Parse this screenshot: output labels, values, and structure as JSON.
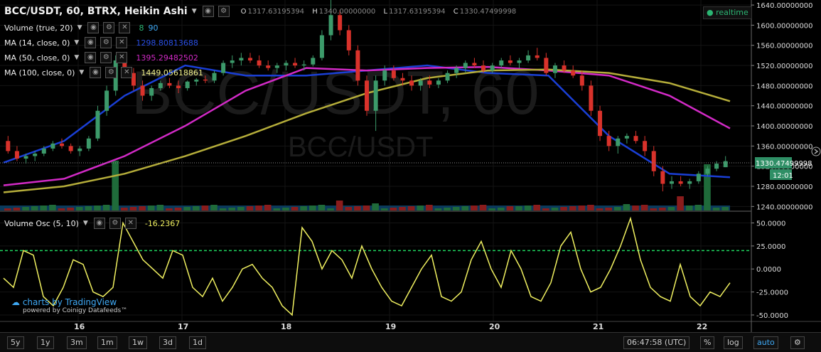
{
  "header": {
    "symbol": "BCC/USDT, 60, BTRX, Heikin Ashi",
    "o_label": "O",
    "o_val": "1317.63195394",
    "h_label": "H",
    "h_val": "1340.00000000",
    "l_label": "L",
    "l_val": "1317.63195394",
    "c_label": "C",
    "c_val": "1330.47499998",
    "realtime": "● realtime"
  },
  "indicators": [
    {
      "name": "Volume (true, 20)",
      "values": [
        "8",
        "90"
      ],
      "colors": [
        "#2bb673",
        "#3fa9f5"
      ]
    },
    {
      "name": "MA (14, close, 0)",
      "values": [
        "1298.80813688"
      ],
      "colors": [
        "#1a3fd6"
      ]
    },
    {
      "name": "MA (50, close, 0)",
      "values": [
        "1395.29482502"
      ],
      "colors": [
        "#d22ac6"
      ]
    },
    {
      "name": "MA (100, close, 0)",
      "values": [
        "1449.05618861"
      ],
      "colors": [
        "#f0f08a"
      ]
    }
  ],
  "osc_legend": {
    "name": "Volume Osc (5, 10)",
    "value": "-16.2367"
  },
  "watermark": {
    "text": "charts by TradingView",
    "sub": "powered by Coinigy Datafeeds™"
  },
  "background_text": {
    "big": "BCC/USDT, 60",
    "small": "BCC/USDT"
  },
  "price_axis": {
    "ticks": [
      1640,
      1600,
      1560,
      1520,
      1480,
      1440,
      1400,
      1360,
      1320,
      1280,
      1240
    ],
    "tick_labels": [
      "1640.00000000",
      "1600.00000000",
      "1560.00000000",
      "1520.00000000",
      "1480.00000000",
      "1440.00000000",
      "1400.00000000",
      "1360.00000000",
      "1320.00000000",
      "1280.00000000",
      "1240.00000000"
    ],
    "last_price": "1330.47499998",
    "countdown": "12:01",
    "range": [
      1232,
      1650
    ]
  },
  "osc_axis": {
    "ticks": [
      50,
      25,
      0,
      -25,
      -50
    ],
    "tick_labels": [
      "50.0000",
      "25.0000",
      "0.0000",
      "-25.0000",
      "-50.0000"
    ],
    "range": [
      -57,
      62
    ],
    "dashed_level": 20
  },
  "time_axis": {
    "labels": [
      "16",
      "17",
      "18",
      "19",
      "20",
      "21",
      "22"
    ]
  },
  "toolbar": {
    "ranges": [
      "5y",
      "1y",
      "3m",
      "1m",
      "1w",
      "3d",
      "1d"
    ],
    "time": "06:47:58 (UTC)",
    "pct": "%",
    "log": "log",
    "auto": "auto"
  },
  "colors": {
    "up": "#3c9a6a",
    "down": "#d9322b",
    "ma14": "#1a3fd6",
    "ma50": "#d22ac6",
    "ma100": "#b5ad3a",
    "osc": "#f0f060",
    "osc_level": "#1ed760"
  },
  "chart_data": {
    "type": "line",
    "xlabel": "",
    "ylabel": "",
    "x_labels": [
      "16",
      "17",
      "18",
      "19",
      "20",
      "21",
      "22"
    ],
    "series": [
      {
        "name": "MA (14, close, 0)",
        "values": [
          1327,
          1370,
          1460,
          1520,
          1500,
          1500,
          1510,
          1520,
          1505,
          1500,
          1380,
          1305,
          1298
        ]
      },
      {
        "name": "MA (50, close, 0)",
        "values": [
          1282,
          1295,
          1340,
          1400,
          1470,
          1515,
          1510,
          1515,
          1517,
          1510,
          1500,
          1460,
          1395
        ]
      },
      {
        "name": "MA (100, close, 0)",
        "values": [
          1268,
          1280,
          1305,
          1340,
          1380,
          1425,
          1465,
          1495,
          1510,
          1512,
          1505,
          1485,
          1449
        ]
      }
    ],
    "candles": [
      [
        1370,
        1380,
        1345,
        1350
      ],
      [
        1350,
        1360,
        1330,
        1335
      ],
      [
        1335,
        1345,
        1325,
        1340
      ],
      [
        1340,
        1350,
        1330,
        1345
      ],
      [
        1345,
        1360,
        1340,
        1355
      ],
      [
        1355,
        1370,
        1350,
        1365
      ],
      [
        1365,
        1375,
        1355,
        1360
      ],
      [
        1360,
        1365,
        1345,
        1350
      ],
      [
        1350,
        1360,
        1340,
        1355
      ],
      [
        1355,
        1380,
        1350,
        1375
      ],
      [
        1375,
        1440,
        1370,
        1430
      ],
      [
        1430,
        1480,
        1420,
        1470
      ],
      [
        1470,
        1540,
        1460,
        1530
      ],
      [
        1530,
        1545,
        1500,
        1505
      ],
      [
        1505,
        1515,
        1470,
        1480
      ],
      [
        1480,
        1490,
        1450,
        1460
      ],
      [
        1460,
        1480,
        1450,
        1475
      ],
      [
        1475,
        1490,
        1470,
        1485
      ],
      [
        1485,
        1495,
        1475,
        1480
      ],
      [
        1480,
        1490,
        1465,
        1475
      ],
      [
        1475,
        1490,
        1470,
        1488
      ],
      [
        1488,
        1495,
        1480,
        1492
      ],
      [
        1492,
        1500,
        1485,
        1490
      ],
      [
        1490,
        1510,
        1485,
        1505
      ],
      [
        1505,
        1530,
        1500,
        1525
      ],
      [
        1525,
        1540,
        1515,
        1530
      ],
      [
        1530,
        1545,
        1520,
        1535
      ],
      [
        1535,
        1545,
        1525,
        1530
      ],
      [
        1530,
        1540,
        1515,
        1520
      ],
      [
        1520,
        1530,
        1510,
        1515
      ],
      [
        1515,
        1525,
        1505,
        1520
      ],
      [
        1520,
        1530,
        1510,
        1525
      ],
      [
        1525,
        1535,
        1515,
        1520
      ],
      [
        1520,
        1530,
        1510,
        1522
      ],
      [
        1522,
        1540,
        1518,
        1535
      ],
      [
        1535,
        1590,
        1530,
        1580
      ],
      [
        1580,
        1650,
        1570,
        1620
      ],
      [
        1620,
        1630,
        1580,
        1590
      ],
      [
        1590,
        1600,
        1540,
        1550
      ],
      [
        1550,
        1560,
        1480,
        1490
      ],
      [
        1490,
        1500,
        1420,
        1430
      ],
      [
        1430,
        1500,
        1390,
        1490
      ],
      [
        1490,
        1520,
        1480,
        1510
      ],
      [
        1510,
        1520,
        1490,
        1495
      ],
      [
        1495,
        1505,
        1480,
        1490
      ],
      [
        1490,
        1500,
        1470,
        1480
      ],
      [
        1480,
        1495,
        1470,
        1490
      ],
      [
        1490,
        1500,
        1475,
        1482
      ],
      [
        1482,
        1495,
        1475,
        1490
      ],
      [
        1490,
        1510,
        1485,
        1505
      ],
      [
        1505,
        1520,
        1495,
        1515
      ],
      [
        1515,
        1530,
        1505,
        1525
      ],
      [
        1525,
        1535,
        1515,
        1520
      ],
      [
        1520,
        1530,
        1505,
        1510
      ],
      [
        1510,
        1525,
        1505,
        1520
      ],
      [
        1520,
        1535,
        1515,
        1530
      ],
      [
        1530,
        1540,
        1520,
        1525
      ],
      [
        1525,
        1535,
        1515,
        1530
      ],
      [
        1530,
        1550,
        1525,
        1540
      ],
      [
        1540,
        1555,
        1530,
        1535
      ],
      [
        1535,
        1545,
        1500,
        1505
      ],
      [
        1505,
        1525,
        1495,
        1520
      ],
      [
        1520,
        1530,
        1505,
        1510
      ],
      [
        1510,
        1520,
        1495,
        1500
      ],
      [
        1500,
        1510,
        1470,
        1480
      ],
      [
        1480,
        1490,
        1420,
        1430
      ],
      [
        1430,
        1440,
        1370,
        1380
      ],
      [
        1380,
        1390,
        1350,
        1360
      ],
      [
        1360,
        1380,
        1345,
        1375
      ],
      [
        1375,
        1385,
        1365,
        1380
      ],
      [
        1380,
        1390,
        1365,
        1370
      ],
      [
        1370,
        1380,
        1340,
        1350
      ],
      [
        1350,
        1360,
        1300,
        1310
      ],
      [
        1310,
        1320,
        1270,
        1285
      ],
      [
        1285,
        1300,
        1275,
        1290
      ],
      [
        1290,
        1300,
        1280,
        1285
      ],
      [
        1285,
        1295,
        1275,
        1290
      ],
      [
        1290,
        1310,
        1285,
        1305
      ],
      [
        1305,
        1320,
        1300,
        1315
      ],
      [
        1315,
        1330,
        1310,
        1325
      ],
      [
        1318,
        1340,
        1318,
        1330
      ]
    ],
    "volume_osc": [
      -10,
      -20,
      20,
      15,
      -30,
      -40,
      -20,
      10,
      5,
      -25,
      -30,
      -20,
      50,
      30,
      10,
      0,
      -10,
      20,
      15,
      -20,
      -30,
      -10,
      -35,
      -20,
      0,
      5,
      -10,
      -20,
      -40,
      -50,
      45,
      30,
      0,
      20,
      10,
      -10,
      25,
      0,
      -20,
      -35,
      -40,
      -20,
      0,
      15,
      -30,
      -35,
      -25,
      10,
      30,
      0,
      -20,
      20,
      0,
      -30,
      -35,
      -15,
      25,
      40,
      0,
      -25,
      -20,
      0,
      25,
      55,
      10,
      -20,
      -30,
      -35,
      5,
      -30,
      -40,
      -25,
      -30,
      -15
    ]
  }
}
